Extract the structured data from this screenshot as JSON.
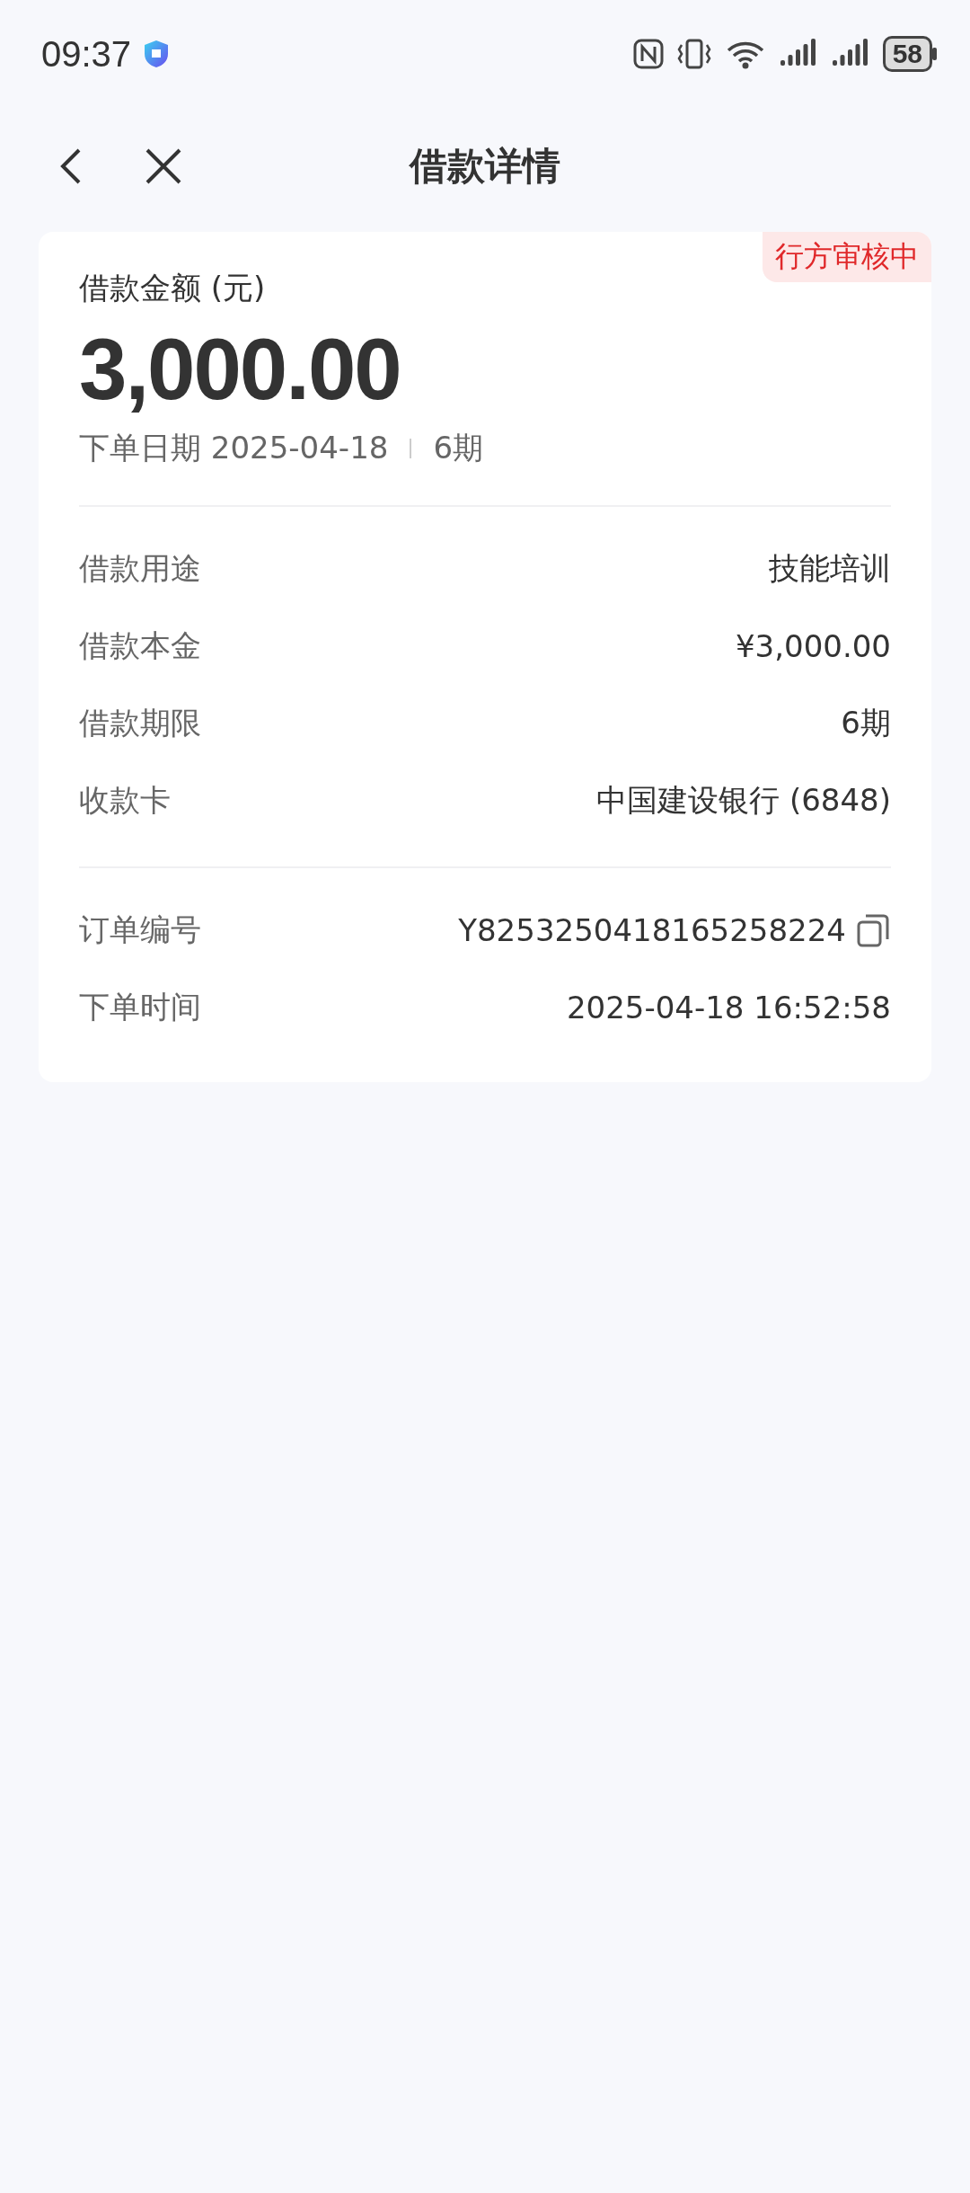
{
  "status_bar": {
    "time": "09:37",
    "battery": "58"
  },
  "nav": {
    "title": "借款详情"
  },
  "card": {
    "badge": "行方审核中",
    "amount_label": "借款金额 (元)",
    "amount": "3,000.00",
    "date": "下单日期 2025-04-18",
    "term": "6期",
    "sections": [
      [
        {
          "label": "借款用途",
          "value": "技能培训",
          "kind": "plain"
        },
        {
          "label": "借款本金",
          "value": "¥3,000.00",
          "kind": "plain"
        },
        {
          "label": "借款期限",
          "value": "6期",
          "kind": "plain"
        },
        {
          "label": "收款卡",
          "value": "中国建设银行 (6848)",
          "kind": "plain"
        }
      ],
      [
        {
          "label": "订单编号",
          "value": "Y8253250418165258224",
          "kind": "copyable"
        },
        {
          "label": "下单时间",
          "value": "2025-04-18 16:52:58",
          "kind": "plain"
        }
      ]
    ]
  }
}
